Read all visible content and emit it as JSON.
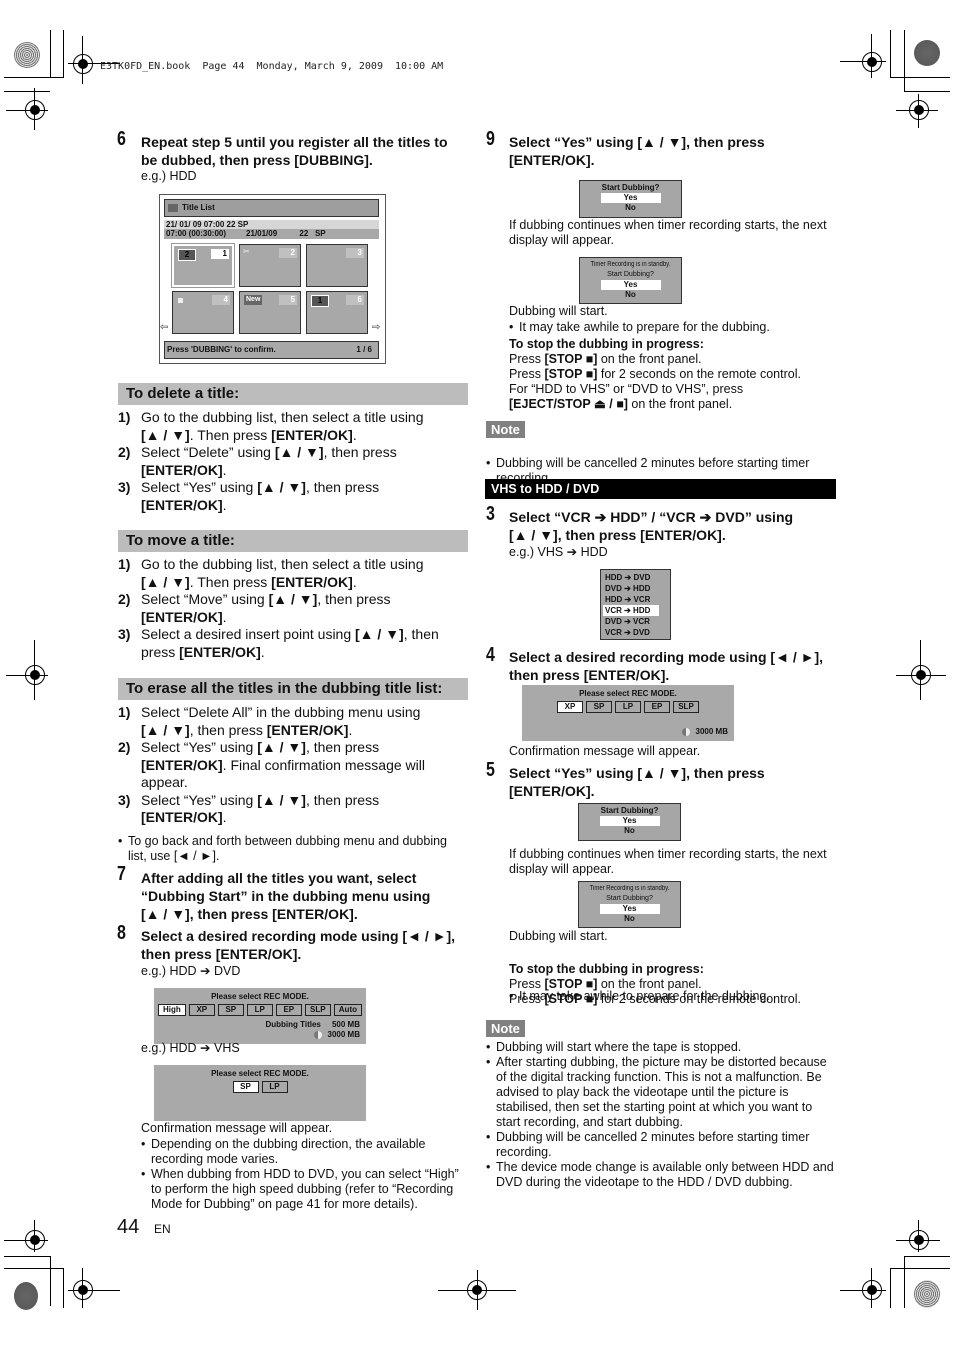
{
  "print_header": "E3TK0FD_EN.book  Page 44  Monday, March 9, 2009  10:00 AM",
  "page": {
    "number": "44",
    "lang": "EN"
  },
  "left": {
    "step6": {
      "num": "6",
      "title_line1": "Repeat step 5 until you register all the titles to",
      "title_line2": "be dubbed, then press [DUBBING].",
      "eg": "e.g.) HDD"
    },
    "title_list": {
      "header": "Title List",
      "info_line1": "21/ 01/ 09  07:00 22  SP",
      "info_line2": "07:00 (00:30:00)         21/01/09          22   SP",
      "thumbs": [
        {
          "order": "2",
          "num": "1",
          "selected": true
        },
        {
          "icon": "protect",
          "num": "2"
        },
        {
          "num": "3"
        },
        {
          "icon": "lock",
          "num": "4"
        },
        {
          "badge": "New",
          "num": "5"
        },
        {
          "order": "1",
          "num": "6"
        }
      ],
      "footer_msg": "Press 'DUBBING' to confirm.",
      "footer_page": "1 / 6"
    },
    "delete": {
      "heading": "To delete a title:",
      "items": [
        {
          "n": "1)",
          "l1": "Go to the dubbing list, then select a title using",
          "l2a": "[▲ / ▼]",
          "l2b": ". Then press ",
          "l2c": "[ENTER/OK]",
          "l2d": "."
        },
        {
          "n": "2)",
          "l1a": "Select “Delete” using ",
          "l1b": "[▲ / ▼]",
          "l1c": ", then press",
          "l2": "[ENTER/OK]"
        },
        {
          "n": "3)",
          "l1a": "Select “Yes” using ",
          "l1b": "[▲ / ▼]",
          "l1c": ", then press",
          "l2": "[ENTER/OK]"
        }
      ]
    },
    "move": {
      "heading": "To move a title:",
      "items": [
        {
          "n": "1)",
          "l1": "Go to the dubbing list, then select a title using",
          "l2a": "[▲ / ▼]",
          "l2b": ". Then press ",
          "l2c": "[ENTER/OK]",
          "l2d": "."
        },
        {
          "n": "2)",
          "l1a": "Select “Move” using ",
          "l1b": "[▲ / ▼]",
          "l1c": ", then press",
          "l2": "[ENTER/OK]"
        },
        {
          "n": "3)",
          "l1a": "Select a desired insert point using ",
          "l1b": "[▲ / ▼]",
          "l1c": ", then",
          "l2a": "press ",
          "l2b": "[ENTER/OK]"
        }
      ]
    },
    "erase": {
      "heading": "To erase all the titles in the dubbing title list:",
      "items": [
        {
          "n": "1)",
          "l1": "Select “Delete All” in the dubbing menu using",
          "l2a": "[▲ / ▼]",
          "l2b": ", then press ",
          "l2c": "[ENTER/OK]"
        },
        {
          "n": "2)",
          "l1a": "Select “Yes” using ",
          "l1b": "[▲ / ▼]",
          "l1c": ", then press",
          "l2a": "[ENTER/OK]",
          "l2b": ". Final confirmation message will",
          "l3": "appear."
        },
        {
          "n": "3)",
          "l1a": "Select “Yes” using ",
          "l1b": "[▲ / ▼]",
          "l1c": ", then press",
          "l2": "[ENTER/OK]"
        }
      ],
      "bullet": "To go back and forth between dubbing menu and dubbing list, use [◄ / ►]."
    },
    "step7": {
      "num": "7",
      "lines": [
        "After adding all the titles you want, select",
        "“Dubbing Start” in the dubbing menu using",
        "[▲ / ▼], then press [ENTER/OK]."
      ]
    },
    "step8": {
      "num": "8",
      "lines": [
        "Select a desired recording mode using [◄ / ►],",
        "then press [ENTER/OK]."
      ],
      "eg1": "e.g.) HDD ➔ DVD",
      "osd1": {
        "title": "Please select REC MODE.",
        "modes": [
          "High",
          "XP",
          "SP",
          "LP",
          "EP",
          "SLP",
          "Auto"
        ],
        "selected": "High",
        "dubbing_label": "Dubbing Titles",
        "dubbing_size": "500 MB",
        "free_size": "3000 MB"
      },
      "eg2": "e.g.) HDD ➔ VHS",
      "osd2": {
        "title": "Please select REC MODE.",
        "modes": [
          "SP",
          "LP"
        ],
        "selected": "SP"
      },
      "confirm": "Confirmation message will appear.",
      "bullets": [
        "Depending on the dubbing direction, the available recording mode varies.",
        "When dubbing from HDD to DVD, you can select “High” to perform the high speed dubbing (refer to “Recording Mode for Dubbing” on page 41 for more details)."
      ]
    }
  },
  "right": {
    "step9": {
      "num": "9",
      "lines": [
        "Select “Yes” using [▲ / ▼], then press",
        "[ENTER/OK]."
      ],
      "osd_a": {
        "title": "Start Dubbing?",
        "yes": "Yes",
        "no": "No"
      },
      "cont": "If dubbing continues when timer recording starts, the next display will appear.",
      "osd_b": {
        "line1": "Timer Recording is in standby.",
        "title": "Start Dubbing?",
        "yes": "Yes",
        "no": "No"
      },
      "start": "Dubbing will start.",
      "bullet": "It may take awhile to prepare for the dubbing.",
      "stop_head": "To stop the dubbing in progress:",
      "stop_lines": [
        {
          "a": "Press ",
          "b": "[STOP ■]",
          "c": " on the front panel."
        },
        {
          "a": "Press ",
          "b": "[STOP ■]",
          "c": " for 2 seconds on the remote control."
        },
        {
          "a": "For “HDD to VHS” or “DVD to VHS”, press",
          "b": "",
          "c": ""
        },
        {
          "a": "",
          "b": "[EJECT/STOP ⏏ / ■]",
          "c": " on the front panel."
        }
      ]
    },
    "note1": {
      "label": "Note",
      "bullets": [
        "Dubbing will be cancelled 2 minutes before starting timer recording."
      ]
    },
    "section_bar": "VHS to HDD / DVD",
    "step3": {
      "num": "3",
      "lines": [
        "Select “VCR ➔ HDD” / “VCR ➔ DVD” using",
        "[▲ / ▼], then press [ENTER/OK]."
      ],
      "eg": "e.g.) VHS ➔ HDD",
      "menu": [
        "HDD ➔ DVD",
        "DVD ➔ HDD",
        "HDD ➔ VCR",
        "VCR ➔ HDD",
        "DVD ➔ VCR",
        "VCR ➔ DVD"
      ],
      "selected_index": 3
    },
    "step4": {
      "num": "4",
      "lines": [
        "Select a desired recording mode using [◄ / ►],",
        "then press [ENTER/OK]."
      ],
      "osd": {
        "title": "Please select REC MODE.",
        "modes": [
          "XP",
          "SP",
          "LP",
          "EP",
          "SLP"
        ],
        "selected": "XP",
        "free_size": "3000 MB"
      },
      "confirm": "Confirmation message will appear."
    },
    "step5": {
      "num": "5",
      "lines": [
        "Select “Yes” using [▲ / ▼], then press",
        "[ENTER/OK]."
      ],
      "osd_a": {
        "title": "Start Dubbing?",
        "yes": "Yes",
        "no": "No"
      },
      "cont": "If dubbing continues when timer recording starts, the next display will appear.",
      "osd_b": {
        "line1": "Timer Recording is in standby.",
        "title": "Start Dubbing?",
        "yes": "Yes",
        "no": "No"
      },
      "start": "Dubbing will start.",
      "bullet": "It may take awhile to prepare for the dubbing.",
      "stop_head": "To stop the dubbing in progress:",
      "stop_lines": [
        {
          "a": "Press ",
          "b": "[STOP ■]",
          "c": " on the front panel."
        },
        {
          "a": "Press ",
          "b": "[STOP ■]",
          "c": " for 2 seconds on the remote control."
        }
      ]
    },
    "note2": {
      "label": "Note",
      "bullets": [
        "Dubbing will start where the tape is stopped.",
        "After starting dubbing, the picture may be distorted because of the digital tracking function. This is not a malfunction. Be advised to play back the videotape until the picture is stabilised, then set the starting point at which you want to start recording, and start dubbing.",
        "Dubbing will be cancelled 2 minutes before starting timer recording.",
        "The device mode change is available only between HDD and DVD during the videotape to the HDD / DVD dubbing."
      ]
    }
  }
}
